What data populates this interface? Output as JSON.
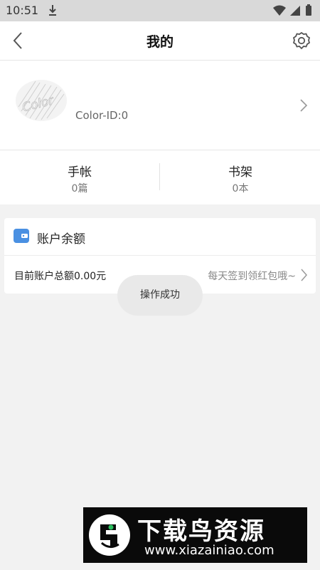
{
  "status_bar": {
    "time": "10:51",
    "icons": [
      "download-icon",
      "wifi-icon",
      "signal-icon",
      "battery-icon"
    ]
  },
  "header": {
    "title": "我的",
    "back_icon": "chevron-left-icon",
    "settings_icon": "gear-icon"
  },
  "profile": {
    "avatar_text": "Color",
    "color_id": "Color-ID:0"
  },
  "stats": [
    {
      "label": "手帐",
      "value": "0篇"
    },
    {
      "label": "书架",
      "value": "0本"
    }
  ],
  "wallet": {
    "title": "账户余额",
    "total_text": "目前账户总额0.00元",
    "promo_text": "每天签到领红包哦~"
  },
  "toast": {
    "message": "操作成功"
  },
  "watermark": {
    "name": "下载鸟资源",
    "url": "www.xiazainiao.com"
  },
  "colors": {
    "accent_blue": "#4a90e2",
    "page_background": "#f2f2f2",
    "status_bar": "#d9d9d9"
  }
}
